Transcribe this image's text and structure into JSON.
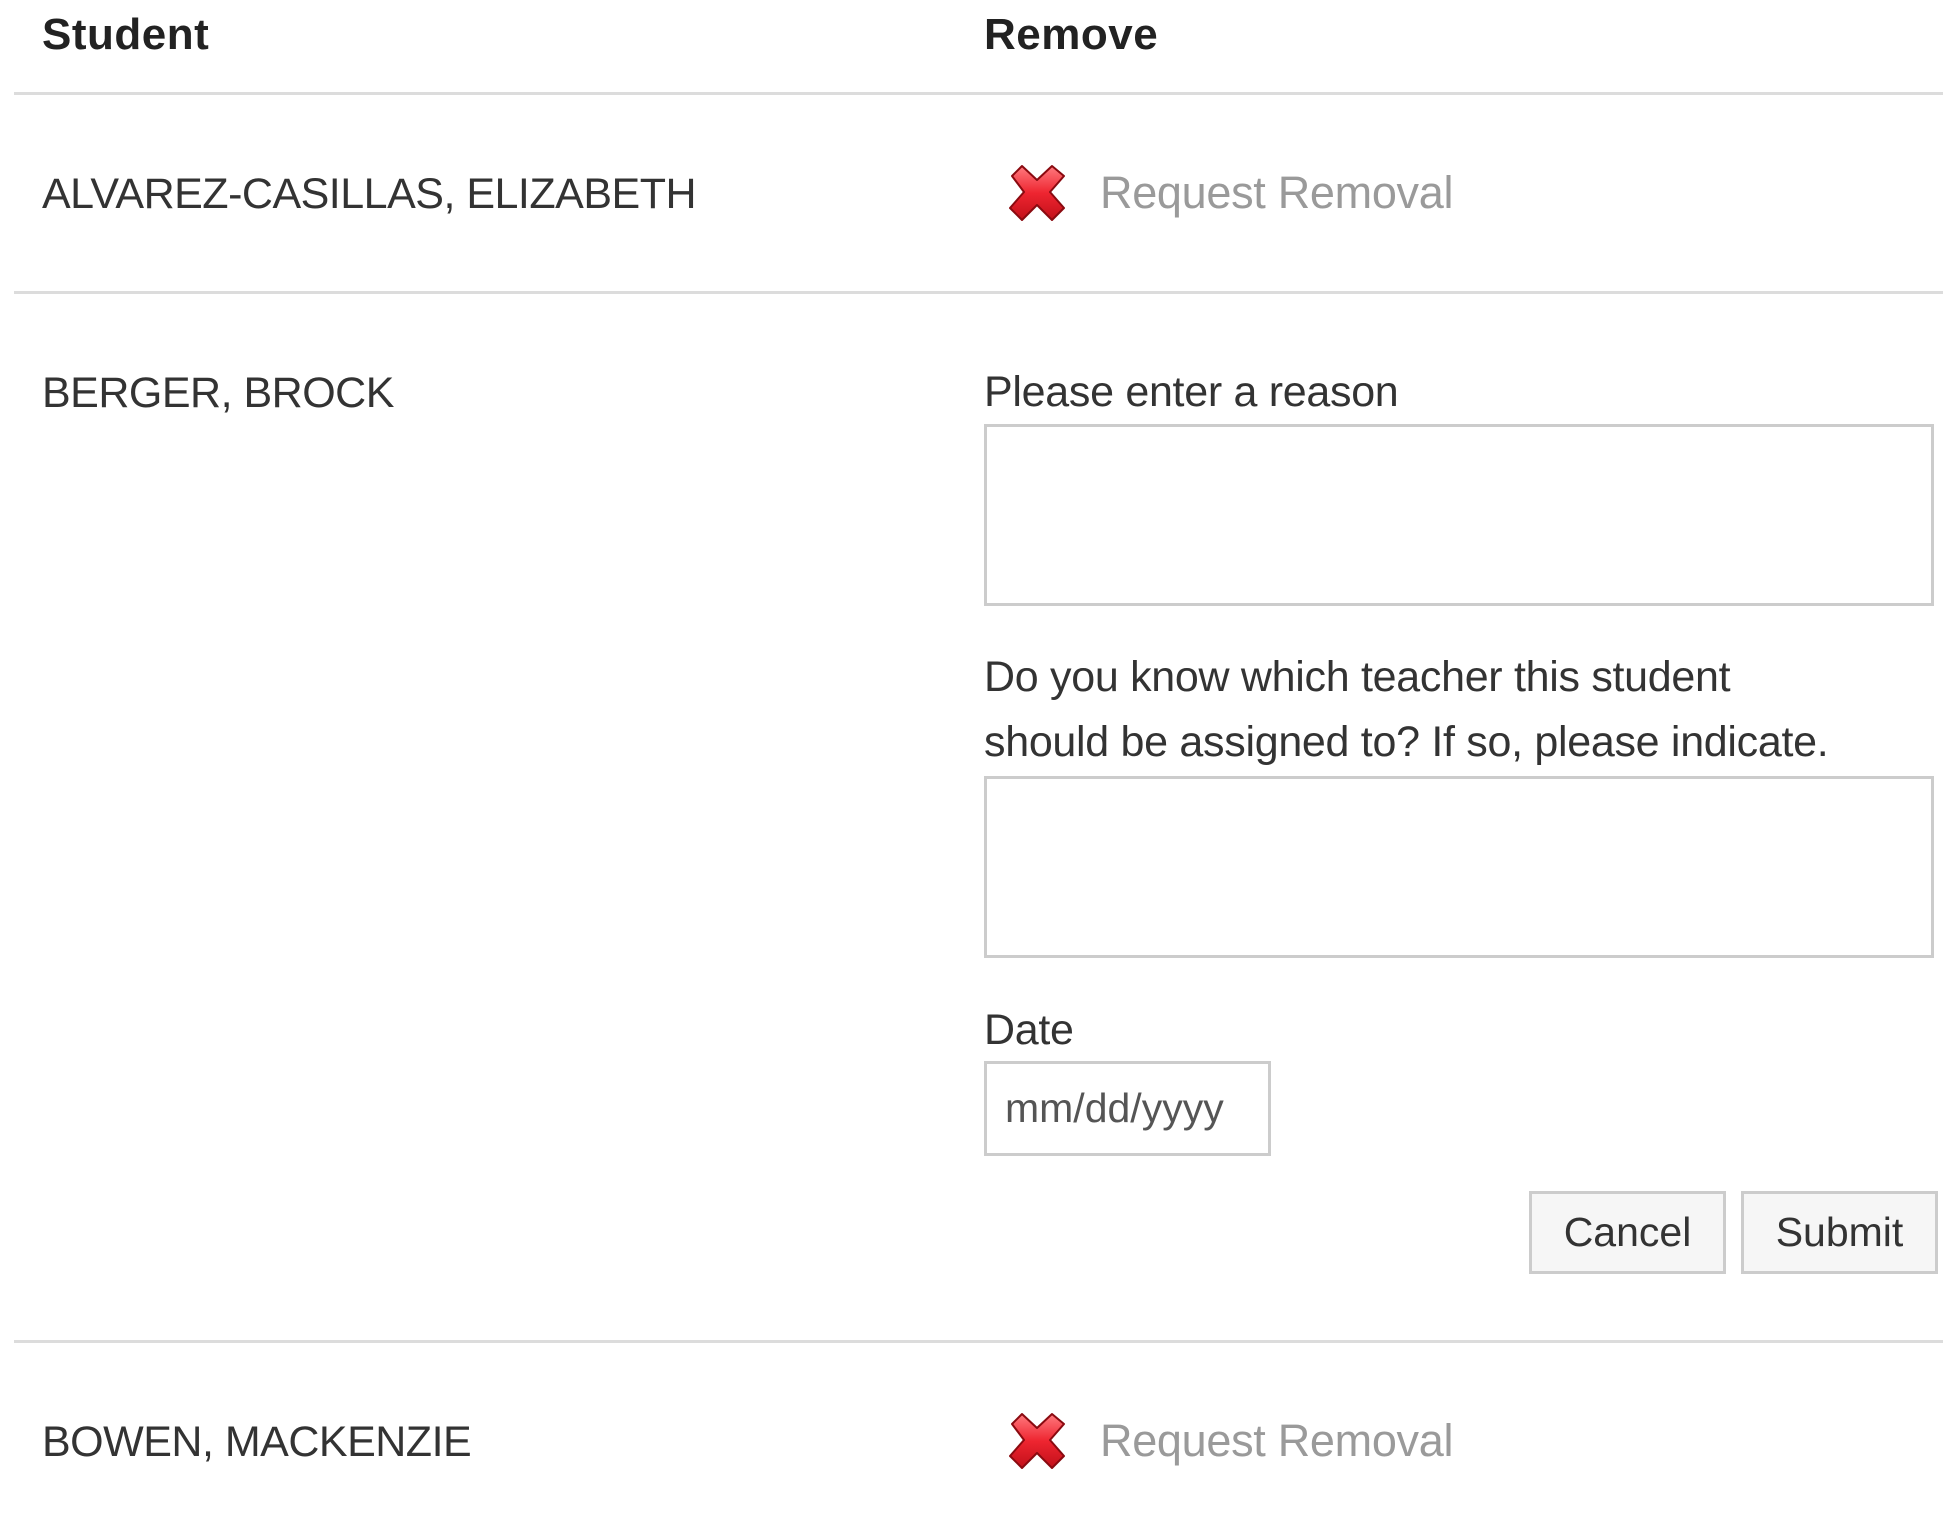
{
  "table": {
    "headers": {
      "student": "Student",
      "remove": "Remove"
    },
    "rows": [
      {
        "student": "ALVAREZ-CASILLAS, ELIZABETH",
        "action_label": "Request Removal",
        "icon": "red-x-icon"
      },
      {
        "student": "BERGER, BROCK",
        "form": {
          "reason_label": "Please enter a reason",
          "reason_value": "",
          "teacher_label_line1": "Do you know which teacher this student",
          "teacher_label_line2": "should be assigned to? If so, please indicate.",
          "teacher_value": "",
          "date_label": "Date",
          "date_placeholder": "mm/dd/yyyy",
          "cancel_label": "Cancel",
          "submit_label": "Submit"
        }
      },
      {
        "student": "BOWEN, MACKENZIE",
        "action_label": "Request Removal",
        "icon": "red-x-icon"
      }
    ]
  },
  "colors": {
    "icon_red": "#e8202a",
    "link_gray": "#9a9a9a",
    "divider": "#dcdcdc"
  }
}
